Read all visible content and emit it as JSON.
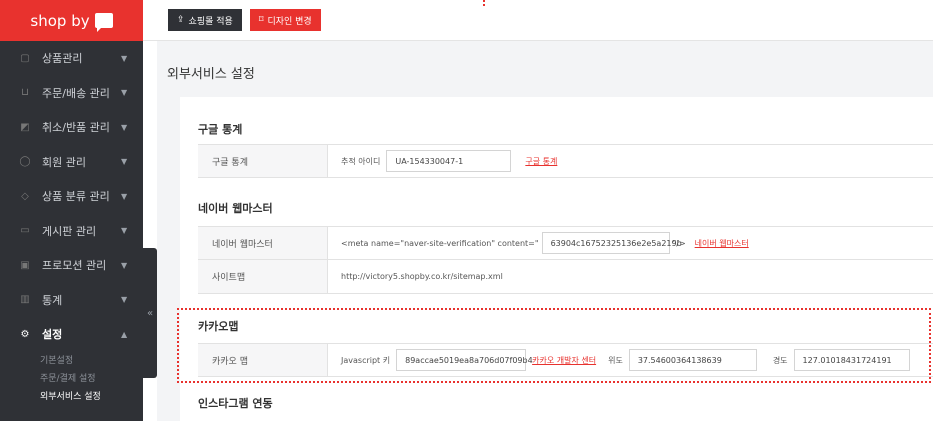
{
  "brand": {
    "logo_text": "shop by"
  },
  "sidebar": {
    "items": [
      {
        "label": "상품관리",
        "icon": "box-icon"
      },
      {
        "label": "주문/배송 관리",
        "icon": "cart-icon"
      },
      {
        "label": "취소/반품 관리",
        "icon": "return-icon"
      },
      {
        "label": "회원 관리",
        "icon": "user-icon"
      },
      {
        "label": "상품 분류 관리",
        "icon": "tag-icon"
      },
      {
        "label": "게시판 관리",
        "icon": "board-icon"
      },
      {
        "label": "프로모션 관리",
        "icon": "gift-icon"
      },
      {
        "label": "통계",
        "icon": "chart-icon"
      },
      {
        "label": "설정",
        "icon": "gear-icon"
      }
    ],
    "submenu": [
      "기본설정",
      "주문/결제 설정",
      "외부서비스 설정"
    ],
    "collapse": "«"
  },
  "toolbar": {
    "apply_label": "쇼핑몰 적용",
    "design_label": "디자인 변경"
  },
  "page": {
    "title": "외부서비스 설정"
  },
  "google": {
    "section_title": "구글 통계",
    "row_label": "구글 통계",
    "field_label": "추적 아이디",
    "tracking_id": "UA-154330047-1",
    "link": "구글 통계"
  },
  "naver": {
    "section_title": "네이버 웹마스터",
    "row_label": "네이버 웹마스터",
    "meta_prefix": "<meta name=\"naver-site-verification\" content=\"",
    "meta_value": "63904c16752325136e2e5a219b",
    "meta_suffix": "\"/>",
    "link": "네이버 웹마스터",
    "sitemap_label": "사이트맵",
    "sitemap_url": "http://victory5.shopby.co.kr/sitemap.xml"
  },
  "kakao": {
    "section_title": "카카오맵",
    "row_label": "카카오 맵",
    "js_key_label": "Javascript 키",
    "js_key": "89accae5019ea8a706d07f09b4",
    "dev_link": "카카오 개발자 센터",
    "lat_label": "위도",
    "lat": "37.54600364138639",
    "lng_label": "경도",
    "lng": "127.01018431724191"
  },
  "instagram": {
    "section_title": "인스타그램 연동"
  },
  "colors": {
    "accent": "#e8322e",
    "sidebar_bg": "#2f3136",
    "main_bg": "#f3f4f6"
  }
}
